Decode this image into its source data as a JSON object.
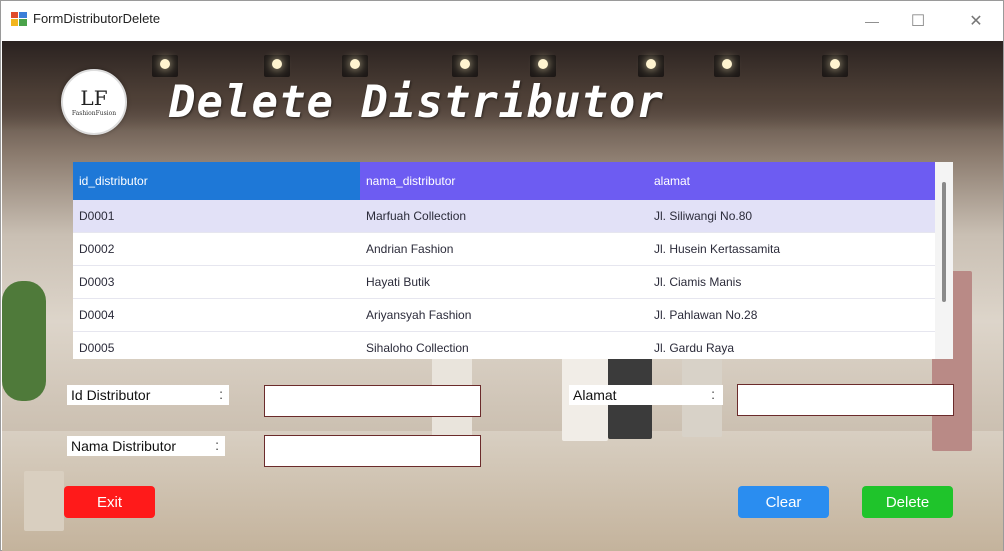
{
  "window": {
    "title": "FormDistributorDelete",
    "minimize_glyph": "—",
    "maximize_glyph": "☐",
    "close_glyph": "✕"
  },
  "logo": {
    "mark": "LF",
    "text": "FashionFusion"
  },
  "heading": "Delete Distributor",
  "grid": {
    "columns": [
      "id_distributor",
      "nama_distributor",
      "alamat"
    ],
    "rows": [
      [
        "D0001",
        "Marfuah Collection",
        "Jl. Siliwangi No.80"
      ],
      [
        "D0002",
        "Andrian Fashion",
        "Jl. Husein Kertassamita"
      ],
      [
        "D0003",
        "Hayati Butik",
        "Jl. Ciamis Manis"
      ],
      [
        "D0004",
        "Ariyansyah Fashion",
        "Jl. Pahlawan No.28"
      ],
      [
        "D0005",
        "Sihaloho Collection",
        "Jl. Gardu Raya"
      ]
    ],
    "selected_row": 0
  },
  "form": {
    "id_label": "Id Distributor",
    "nama_label": "Nama Distributor",
    "alamat_label": "Alamat",
    "colon": ":",
    "id_value": "",
    "nama_value": "",
    "alamat_value": ""
  },
  "buttons": {
    "exit": "Exit",
    "clear": "Clear",
    "delete": "Delete"
  },
  "colors": {
    "header_first": "#1e78d7",
    "header": "#6d5cf2",
    "exit": "#ff1a1a",
    "clear": "#2a8df0",
    "delete": "#1fc42b"
  }
}
